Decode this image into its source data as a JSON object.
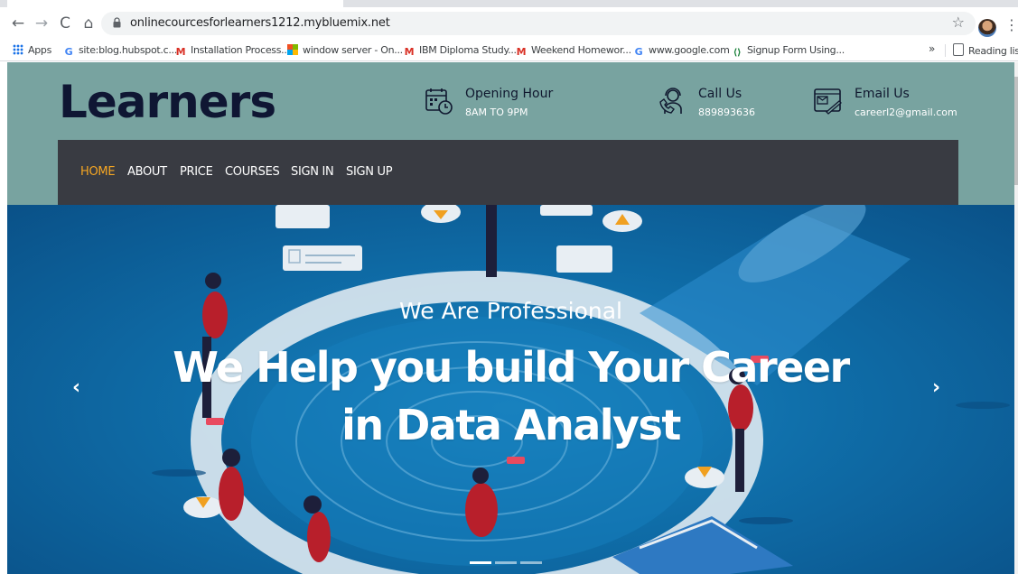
{
  "browser": {
    "url": "onlinecourcesforlearners1212.mybluemix.net",
    "bookmarks": [
      {
        "label": "Apps",
        "icon": "apps-grid-icon"
      },
      {
        "label": "site:blog.hubspot.c...",
        "icon": "google-icon"
      },
      {
        "label": "Installation Process...",
        "icon": "gmail-icon"
      },
      {
        "label": "window server - On...",
        "icon": "windows-icon"
      },
      {
        "label": "IBM Diploma Study...",
        "icon": "gmail-icon"
      },
      {
        "label": "Weekend Homewor...",
        "icon": "gmail-icon"
      },
      {
        "label": "www.google.com",
        "icon": "google-icon"
      },
      {
        "label": "Signup Form Using...",
        "icon": "code-icon"
      }
    ],
    "more_label": "»",
    "reading_list_label": "Reading list"
  },
  "site": {
    "logo": "Learners",
    "info": [
      {
        "title": "Opening Hour",
        "value": "8AM TO 9PM",
        "icon": "calendar-clock-icon"
      },
      {
        "title": "Call Us",
        "value": "889893636",
        "icon": "support-agent-icon"
      },
      {
        "title": "Email Us",
        "value": "careerl2@gmail.com",
        "icon": "email-icon"
      }
    ],
    "nav": [
      "HOME",
      "ABOUT",
      "PRICE",
      "COURSES",
      "SIGN IN",
      "SIGN UP"
    ],
    "active_nav": "HOME"
  },
  "hero": {
    "tagline": "We Are Professional",
    "headline_line1": "We Help you build Your Career",
    "headline_line2": "in Data Analyst",
    "prev_label": "‹",
    "next_label": "›",
    "slides": 3,
    "active_slide": 1
  },
  "colors": {
    "header_bg": "#78a3a0",
    "nav_bg": "#393b42",
    "nav_active": "#f5a623",
    "logo": "#0f1633",
    "hero_blue": "#0f6da8"
  }
}
